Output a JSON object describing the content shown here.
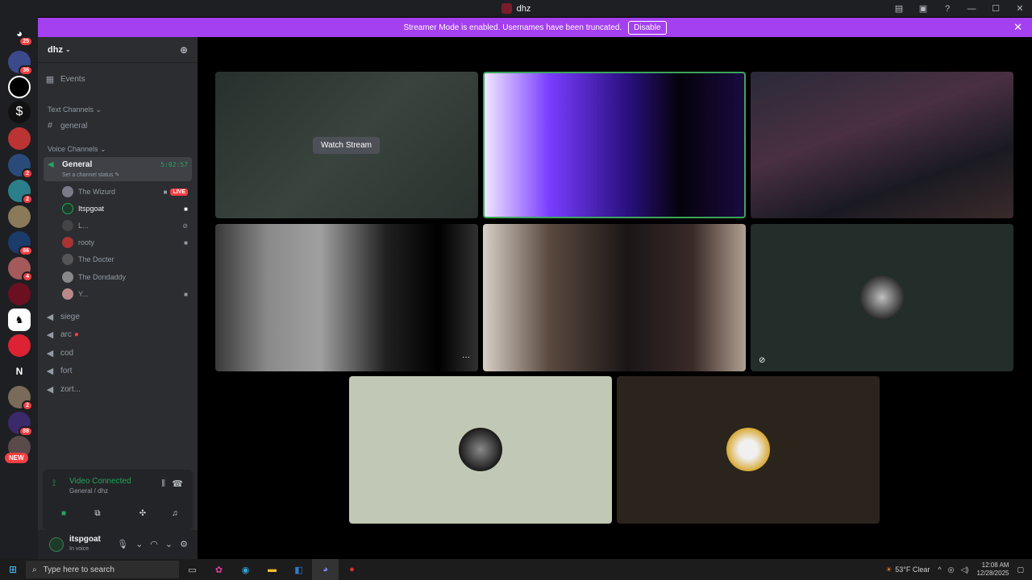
{
  "window": {
    "title": "dhz"
  },
  "banner": {
    "text": "Streamer Mode is enabled. Usernames have been truncated.",
    "button": "Disable"
  },
  "guild_badges": [
    "25",
    "36",
    "2",
    "2",
    "66",
    "4",
    "2",
    "88"
  ],
  "guild_new_badge": "NEW",
  "guild_letter": "N",
  "server": {
    "name": "dhz"
  },
  "events_label": "Events",
  "categories": {
    "text": "Text Channels",
    "voice": "Voice Channels"
  },
  "text_channels": [
    "general"
  ],
  "voice_general": {
    "name": "General",
    "status_placeholder": "Set a channel status",
    "timer": "5:02:57",
    "members": [
      {
        "name": "The Wizurd",
        "live": "LIVE"
      },
      {
        "name": "Itspgoat"
      },
      {
        "name": "L..."
      },
      {
        "name": "rooty"
      },
      {
        "name": "The Docter"
      },
      {
        "name": "The Dondaddy"
      },
      {
        "name": "Y..."
      }
    ]
  },
  "voice_channels": [
    "siege",
    "arc",
    "cod",
    "fort",
    "zort..."
  ],
  "voice_panel": {
    "status": "Video Connected",
    "location": "General / dhz"
  },
  "user": {
    "name": "itspgoat",
    "status": "In voice"
  },
  "stage": {
    "watch_stream": "Watch Stream",
    "more": "···"
  },
  "taskbar": {
    "search_placeholder": "Type here to search",
    "weather": "53°F  Clear",
    "time": "12:08 AM",
    "date": "12/28/2025"
  },
  "colors": {
    "accent_banner": "#a440f0",
    "online_green": "#23a55a",
    "live_red": "#f23f43",
    "speaking_border": "#3ba55c"
  }
}
